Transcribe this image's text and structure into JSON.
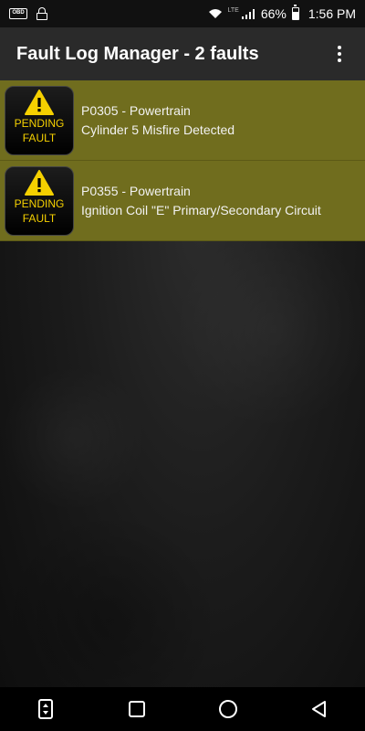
{
  "status_bar": {
    "obd_label": "OBD",
    "lte_label": "LTE",
    "battery": "66%",
    "time": "1:56 PM"
  },
  "app_bar": {
    "title": "Fault Log Manager - 2 faults",
    "overflow_icon": "more-vert-icon"
  },
  "faults": [
    {
      "badge_top": "PENDING",
      "badge_bottom": "FAULT",
      "code": "P0305 - Powertrain",
      "description": "Cylinder 5 Misfire Detected"
    },
    {
      "badge_top": "PENDING",
      "badge_bottom": "FAULT",
      "code": "P0355 - Powertrain",
      "description": "Ignition Coil \"E\" Primary/Secondary Circuit"
    }
  ],
  "colors": {
    "fault_row": "#706d1e",
    "badge_text": "#f5d000",
    "warning_yellow": "#f5d000",
    "app_bar": "#2a2a2a"
  },
  "nav_bar": {
    "icons": [
      "pin-icon",
      "recents-icon",
      "home-icon",
      "back-icon"
    ]
  }
}
